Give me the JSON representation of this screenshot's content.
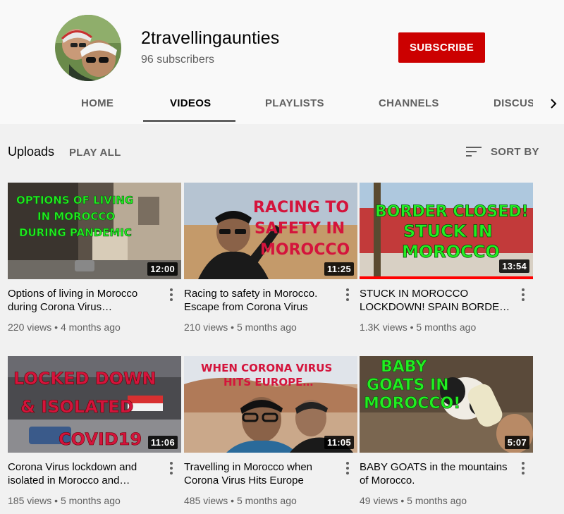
{
  "channel": {
    "name": "2travellingaunties",
    "subscribers": "96 subscribers",
    "subscribe_label": "SUBSCRIBE"
  },
  "tabs": [
    {
      "label": "HOME",
      "active": false
    },
    {
      "label": "VIDEOS",
      "active": true
    },
    {
      "label": "PLAYLISTS",
      "active": false
    },
    {
      "label": "CHANNELS",
      "active": false
    },
    {
      "label": "DISCUS",
      "active": false
    }
  ],
  "section": {
    "title": "Uploads",
    "play_all": "PLAY ALL",
    "sort_label": "SORT BY"
  },
  "videos": [
    {
      "title": "Options of living in Morocco during Corona Virus…",
      "views": "220 views",
      "age": "4 months ago",
      "duration": "12:00",
      "thumb_text": [
        "OPTIONS OF LIVING",
        "IN MOROCCO",
        "DURING PANDEMIC"
      ],
      "watched": false
    },
    {
      "title": "Racing to safety in Morocco. Escape from Corona Virus",
      "views": "210 views",
      "age": "5 months ago",
      "duration": "11:25",
      "thumb_text": [
        "RACING TO",
        "SAFETY IN",
        "MOROCCO"
      ],
      "watched": false
    },
    {
      "title": "STUCK IN MOROCCO LOCKDOWN! SPAIN BORDE…",
      "views": "1.3K views",
      "age": "5 months ago",
      "duration": "13:54",
      "thumb_text": [
        "BORDER CLOSED!",
        "STUCK IN",
        "MOROCCO"
      ],
      "watched": true
    },
    {
      "title": "Corona Virus lockdown and isolated in Morocco and…",
      "views": "185 views",
      "age": "5 months ago",
      "duration": "11:06",
      "thumb_text": [
        "LOCKED DOWN",
        "& ISOLATED",
        "COVID19"
      ],
      "watched": false
    },
    {
      "title": "Travelling in Morocco when Corona Virus Hits Europe",
      "views": "485 views",
      "age": "5 months ago",
      "duration": "11:05",
      "thumb_text": [
        "WHEN CORONA VIRUS",
        "HITS EUROPE…"
      ],
      "watched": false
    },
    {
      "title": "BABY GOATS in the mountains of Morocco.",
      "views": "49 views",
      "age": "5 months ago",
      "duration": "5:07",
      "thumb_text": [
        "BABY",
        "GOATS IN",
        "MOROCCO!"
      ],
      "watched": false
    }
  ],
  "meta_separator": "•",
  "colors": {
    "subscribe_bg": "#cc0000",
    "progress": "#ff0000",
    "thumb_green_text": "#22ee22",
    "thumb_red_text": "#d4143c"
  }
}
